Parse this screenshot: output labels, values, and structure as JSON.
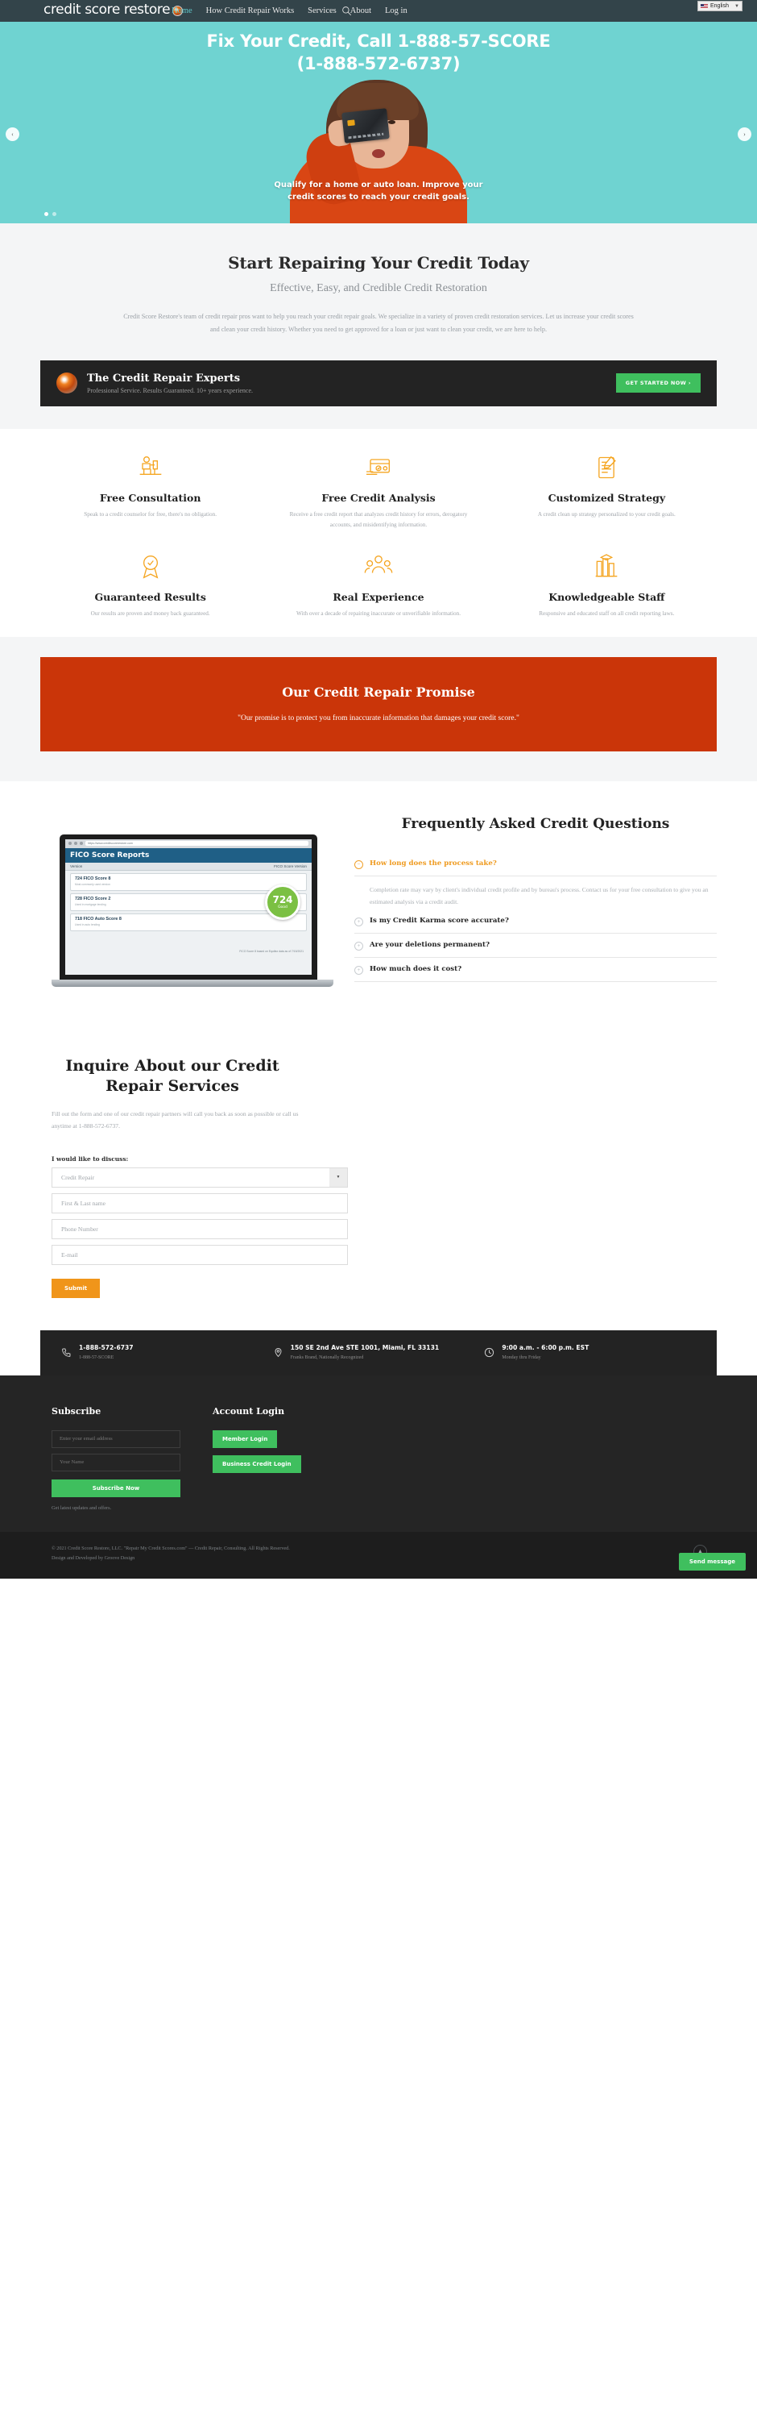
{
  "header": {
    "logo_text": "credit score restore",
    "nav": [
      {
        "label": "Home",
        "active": true
      },
      {
        "label": "How Credit Repair Works",
        "active": false
      },
      {
        "label": "Services",
        "active": false
      },
      {
        "label": "About",
        "active": false
      },
      {
        "label": "Log in",
        "active": false
      }
    ],
    "language": "English",
    "search_icon": "search-icon"
  },
  "hero": {
    "title_line1": "Fix Your Credit, Call 1-888-57-SCORE",
    "title_line2": "(1-888-572-6737)",
    "caption_line1": "Qualify for a home or auto loan. Improve your",
    "caption_line2": "credit scores to reach your credit goals.",
    "prev_label": "‹",
    "next_label": "›",
    "bg_color": "#6fd3d1"
  },
  "intro": {
    "heading": "Start Repairing Your Credit Today",
    "subheading": "Effective, Easy, and Credible Credit Restoration",
    "paragraph": "Credit Score Restore's  team of credit repair pros want to help you reach your credit repair goals. We specialize in a variety of proven credit restoration services. Let us increase your credit scores and clean your credit history. Whether you need to get approved for a loan or just want to clean your credit, we are here to help."
  },
  "experts": {
    "title": "The Credit Repair Experts",
    "subtitle": "Professional Service. Results Guaranteed. 10+ years experience.",
    "button": "GET STARTED NOW  ›"
  },
  "features": [
    {
      "icon": "consultation-icon",
      "title": "Free Consultation",
      "text": "Speak to a credit counselor for free, there's no obligation."
    },
    {
      "icon": "credit-card-analysis-icon",
      "title": "Free Credit Analysis",
      "text": "Receive a free credit report that analyzes credit history for errors, derogatory accounts, and misidentifying information."
    },
    {
      "icon": "strategy-document-icon",
      "title": "Customized Strategy",
      "text": "A credit clean up strategy personalized to your credit goals."
    },
    {
      "icon": "award-badge-icon",
      "title": "Guaranteed Results",
      "text": "Our results are proven and money back guaranteed."
    },
    {
      "icon": "people-group-icon",
      "title": "Real Experience",
      "text": "With over a decade of repairing inaccurate or unverifiable information."
    },
    {
      "icon": "books-icon",
      "title": "Knowledgeable Staff",
      "text": "Responsive and educated staff on all credit reporting laws."
    }
  ],
  "promise": {
    "title": "Our Credit Repair Promise",
    "text": "\"Our promise is to protect you from inaccurate information that damages your credit score.\"",
    "bg_color": "#ca3509"
  },
  "faq": {
    "heading": "Frequently Asked Credit Questions",
    "items": [
      {
        "question": "How long does the process take?",
        "answer": "Completion rate may vary by client's individual credit profile and by bureau's process. Contact us for your free consultation to give you an estimated analysis via a credit audit.",
        "open": true
      },
      {
        "question": "Is my Credit Karma score accurate?",
        "answer": "",
        "open": false
      },
      {
        "question": "Are your deletions permanent?",
        "answer": "",
        "open": false
      },
      {
        "question": "How much does it cost?",
        "answer": "",
        "open": false
      }
    ]
  },
  "laptop": {
    "url": "https://www.creditscorerestore.com",
    "report_title": "FICO Score Reports",
    "col_left": "Version",
    "col_right": "FICO Score Version",
    "rows": [
      {
        "title": "724 FICO Score 8",
        "sub": "Most commonly used version"
      },
      {
        "title": "728 FICO Score 2",
        "sub": "Used in mortgage lending"
      },
      {
        "title": "718 FICO Auto Score 8",
        "sub": "Used in auto lending"
      }
    ],
    "score_value": "724",
    "score_label": "Good",
    "score_note": "FICO Score 8 based on Equifax data as of 7/15/2021"
  },
  "contact": {
    "heading": "Inquire About our Credit Repair Services",
    "lead": "Fill out the form and one of our credit repair partners will call you back as soon as possible or call us anytime at 1-888-572-6737.",
    "select_label": "I would like to discuss:",
    "select_value": "Credit Repair",
    "fields": [
      {
        "name": "name-field",
        "placeholder": "First & Last name"
      },
      {
        "name": "phone-field",
        "placeholder": "Phone Number"
      },
      {
        "name": "email-field",
        "placeholder": "E-mail"
      }
    ],
    "submit": "Submit"
  },
  "infostrip": [
    {
      "icon": "phone-icon",
      "title": "1-888-572-6737",
      "sub": "1-888-57-SCORE"
    },
    {
      "icon": "location-pin-icon",
      "title": "150 SE 2nd Ave STE 1001, Miami, FL 33131",
      "sub": "Franks Brand, Nationally Recognized"
    },
    {
      "icon": "clock-icon",
      "title": "9:00 a.m. - 6:00 p.m. EST",
      "sub": "Monday thru Friday"
    }
  ],
  "footer": {
    "subscribe_title": "Subscribe",
    "email_placeholder": "Enter your email address",
    "name_placeholder": "Your Name",
    "subscribe_button": "Subscribe Now",
    "subscribe_note": "Get latest updates and offers.",
    "account_title": "Account Login",
    "member_login": "Member Login",
    "business_login": "Business Credit Login",
    "copyright_line1": "© 2021 Credit Score Restore, LLC. \"Repair My Credit Scores.com\" — Credit Repair, Consulting. All Rights Reserved.",
    "copyright_line2": "Design and Developed by Groove Design",
    "scroll_top_icon": "scroll-to-top-icon",
    "chat_button": "Send message"
  }
}
